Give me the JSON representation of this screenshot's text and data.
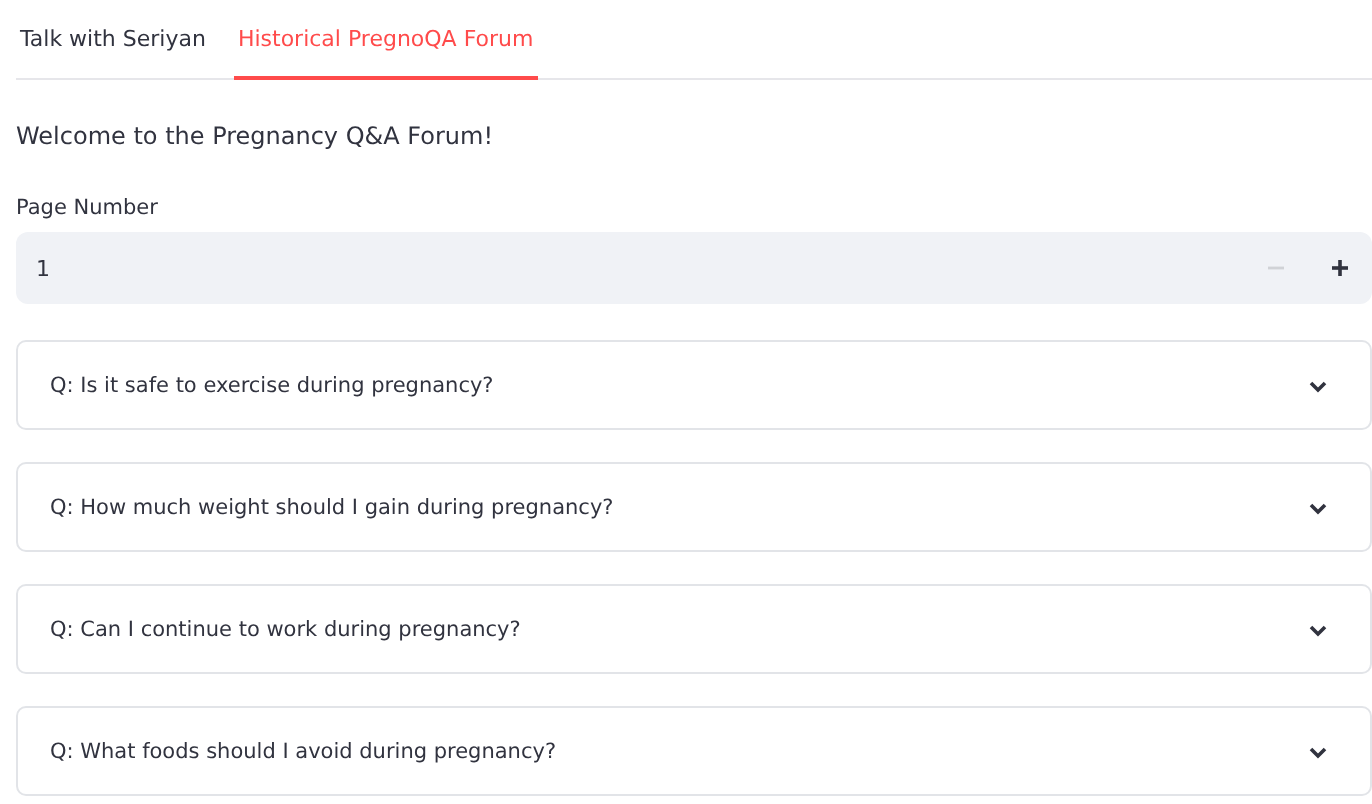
{
  "tabs": [
    {
      "label": "Talk with Seriyan",
      "selected": false
    },
    {
      "label": "Historical PregnoQA Forum",
      "selected": true
    }
  ],
  "heading": "Welcome to the Pregnancy Q&A Forum!",
  "page_number": {
    "label": "Page Number",
    "value": "1",
    "decrement_disabled": true,
    "increment_disabled": false
  },
  "questions": [
    {
      "text": "Q: Is it safe to exercise during pregnancy?",
      "expanded": false
    },
    {
      "text": "Q: How much weight should I gain during pregnancy?",
      "expanded": false
    },
    {
      "text": "Q: Can I continue to work during pregnancy?",
      "expanded": false
    },
    {
      "text": "Q: What foods should I avoid during pregnancy?",
      "expanded": false
    }
  ]
}
